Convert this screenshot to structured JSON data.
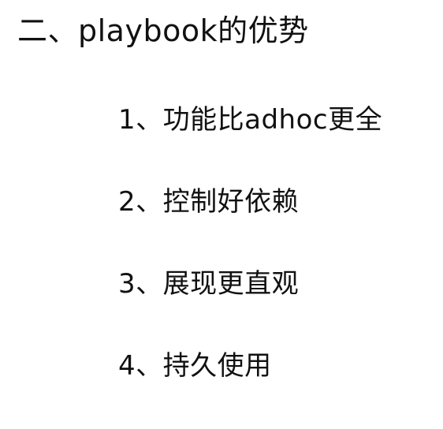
{
  "slide": {
    "title": "二、playbook的优势",
    "items": [
      {
        "label": "1、功能比adhoc更全"
      },
      {
        "label": "2、控制好依赖"
      },
      {
        "label": "3、展现更直观"
      },
      {
        "label": "4、持久使用"
      }
    ]
  }
}
